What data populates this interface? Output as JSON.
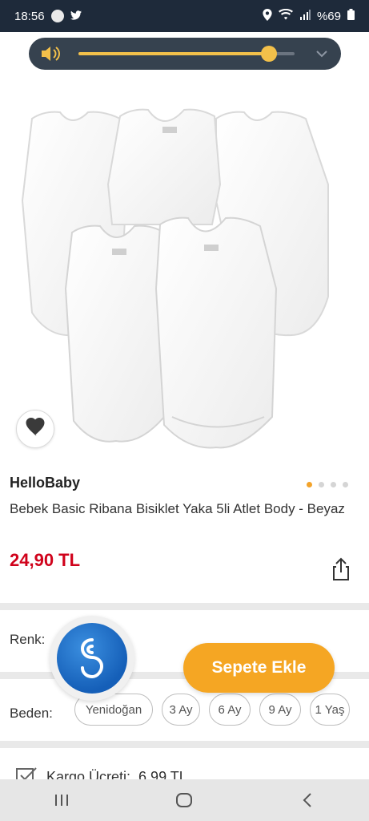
{
  "status_bar": {
    "time": "18:56",
    "battery": "%69"
  },
  "volume": {
    "level": 0.88
  },
  "product": {
    "brand": "HelloBaby",
    "name": "Bebek Basic Ribana Bisiklet Yaka 5li Atlet Body - Beyaz",
    "price": "24,90 TL",
    "image_pages": 4,
    "active_page": 1
  },
  "options": {
    "color_label": "Renk:",
    "size_label": "Beden:",
    "sizes": [
      "Yenidoğan",
      "3 Ay",
      "6 Ay",
      "9 Ay",
      "1 Yaş"
    ]
  },
  "actions": {
    "add_to_cart": "Sepete Ekle"
  },
  "shipping": {
    "label": "Kargo Ücreti:",
    "value": "6,99 TL"
  },
  "colors": {
    "accent": "#f5a623",
    "price": "#d0021b",
    "status_bar": "#1e2a3a",
    "volume_panel": "#36424f",
    "volume_fill": "#f3c04a"
  }
}
